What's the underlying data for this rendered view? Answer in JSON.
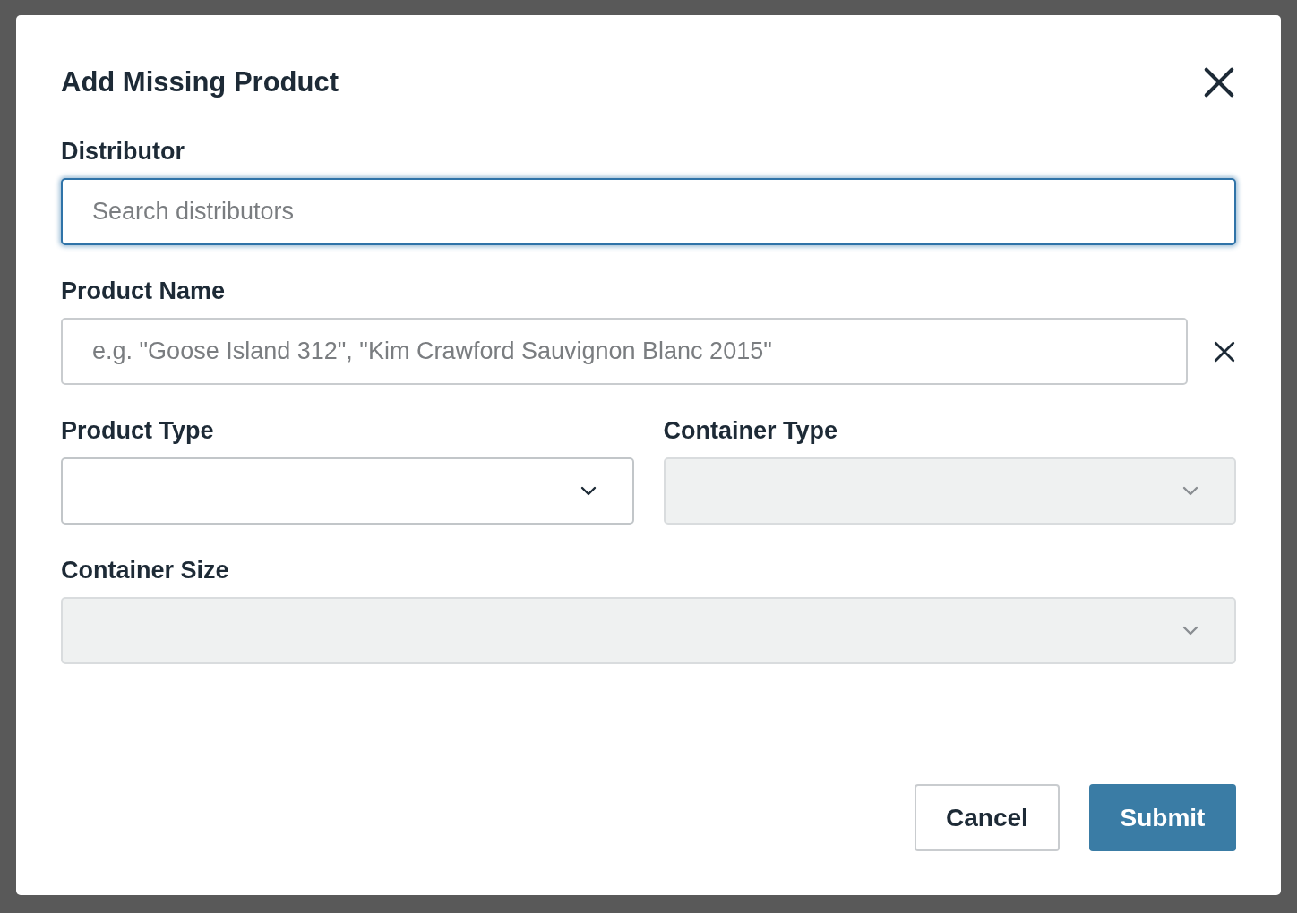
{
  "dialog": {
    "title": "Add Missing Product",
    "rows": [
      {
        "fields": [
          {
            "kind": "search",
            "label": "Distributor",
            "placeholder": "Search distributors",
            "focused": true
          }
        ]
      },
      {
        "fields": [
          {
            "kind": "text",
            "label": "Product Name",
            "placeholder": "e.g. \"Goose Island 312\", \"Kim Crawford Sauvignon Blanc 2015\"",
            "focused": false,
            "clearable": true
          }
        ]
      },
      {
        "fields": [
          {
            "kind": "select",
            "label": "Product Type",
            "disabled": false
          },
          {
            "kind": "select",
            "label": "Container Type",
            "disabled": true
          }
        ]
      },
      {
        "fields": [
          {
            "kind": "select",
            "label": "Container Size",
            "disabled": true
          }
        ]
      }
    ],
    "buttons": [
      {
        "label": "Cancel",
        "kind": "secondary"
      },
      {
        "label": "Submit",
        "kind": "primary"
      }
    ]
  }
}
